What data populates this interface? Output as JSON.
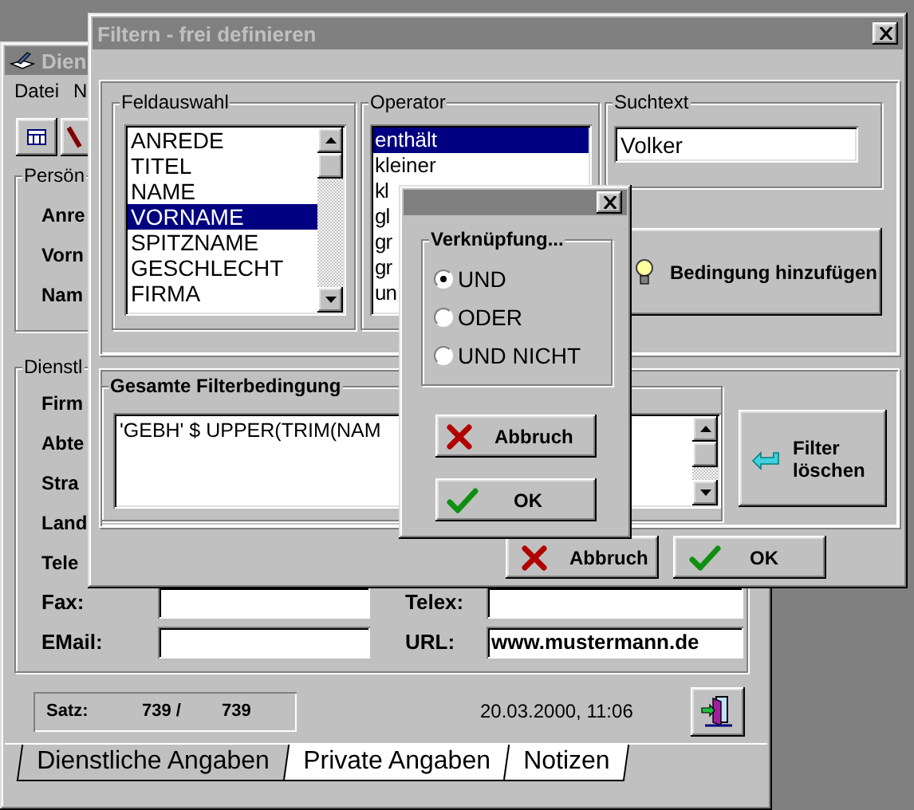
{
  "main_window": {
    "title": "Dien",
    "menu": [
      "Datei",
      "N"
    ],
    "personal_group": {
      "title": "Persön",
      "labels": [
        "Anre",
        "Vorn",
        "Nam"
      ]
    },
    "business_group": {
      "title": "Dienstl",
      "labels": [
        "Firm",
        "Abte",
        "Stra",
        "Land",
        "Tele"
      ],
      "fields": [
        {
          "label": "Fax:"
        },
        {
          "label": "Telex:"
        },
        {
          "label": "EMail:"
        },
        {
          "label": "URL:",
          "value": "www.mustermann.de"
        }
      ]
    },
    "record": {
      "label": "Satz:",
      "current": "739 /",
      "total": "739"
    },
    "timestamp": "20.03.2000, 11:06",
    "tabs": [
      {
        "label": "Dienstliche Angaben",
        "selected": true
      },
      {
        "label": "Private Angaben",
        "selected": false
      },
      {
        "label": "Notizen",
        "selected": false
      }
    ]
  },
  "filter_dialog": {
    "title": "Filtern - frei definieren",
    "field_list": {
      "title": "Feldauswahl",
      "items": [
        {
          "label": "ANREDE",
          "selected": false
        },
        {
          "label": "TITEL",
          "selected": false
        },
        {
          "label": "NAME",
          "selected": false
        },
        {
          "label": "VORNAME",
          "selected": true
        },
        {
          "label": "SPITZNAME",
          "selected": false
        },
        {
          "label": "GESCHLECHT",
          "selected": false
        },
        {
          "label": "FIRMA",
          "selected": false
        }
      ]
    },
    "operator_list": {
      "title": "Operator",
      "items": [
        {
          "label": "enthält",
          "selected": true
        },
        {
          "label": "kleiner",
          "selected": false
        },
        {
          "label": "kl",
          "selected": false
        },
        {
          "label": "gl",
          "selected": false
        },
        {
          "label": "gr",
          "selected": false
        },
        {
          "label": "gr",
          "selected": false
        },
        {
          "label": "un",
          "selected": false
        }
      ]
    },
    "search": {
      "title": "Suchtext",
      "value": "Volker"
    },
    "add_button": "Bedingung hinzufügen",
    "condition": {
      "title": "Gesamte Filterbedingung",
      "value": "'GEBH' $ UPPER(TRIM(NAM"
    },
    "clear_button": "Filter löschen",
    "buttons": [
      {
        "label": "Abbruch",
        "kind": "cancel"
      },
      {
        "label": "OK",
        "kind": "ok"
      }
    ]
  },
  "link_dialog": {
    "group_title": "Verknüpfung...",
    "options": [
      {
        "label": "UND",
        "selected": true
      },
      {
        "label": "ODER",
        "selected": false
      },
      {
        "label": "UND NICHT",
        "selected": false
      }
    ],
    "buttons": [
      {
        "label": "Abbruch",
        "kind": "cancel"
      },
      {
        "label": "OK",
        "kind": "ok"
      }
    ]
  }
}
